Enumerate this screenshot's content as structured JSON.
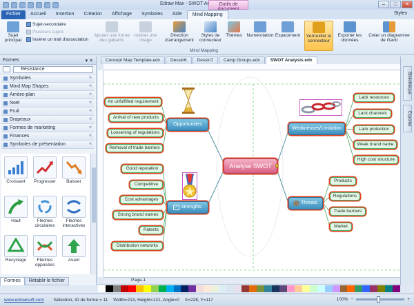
{
  "window": {
    "title": "Edraw Max - SWOT Analysis.edx",
    "contextual_tab": "Outils de document",
    "controls": [
      "–",
      "□",
      "✕"
    ]
  },
  "ribbon_tabs": [
    "Fichier",
    "Accueil",
    "Insertion",
    "Création",
    "Affichage",
    "Symboles",
    "Aide",
    "Mind Mapping"
  ],
  "active_tab": "Mind Mapping",
  "styles_label": "Styles",
  "ribbon": {
    "sujet_principal": "Sujet principal",
    "sujet_secondaire": "Sujet-secondaire",
    "plusieurs_sujets": "Plusieurs sujets",
    "inserer_trait": "Insérer un trait d'association",
    "ajouter_forme": "Ajouter une forme des gabarits",
    "inserer_image": "Insérer une image",
    "direction": "Direction d'arrangement",
    "styles_connecteur": "Styles de connecteur",
    "themes": "Thèmes",
    "numerotation": "Numérotation",
    "espacement": "Espacement",
    "verrouiller": "Verrouiller le connecteur",
    "exporter": "Exporter les données",
    "creer_gantt": "Créer un diagramme de Gantt",
    "group_name": "Mind Mapping"
  },
  "left_panel": {
    "title": "Formes",
    "search_value": "Résistance",
    "libraries": [
      "Symboles",
      "Mind Map Shapes",
      "Arrière-plan",
      "Noël",
      "Fruit",
      "Drapeaux",
      "Formes de marketing",
      "Finances",
      "Symboles de présentation"
    ],
    "shapes": [
      "Croissant",
      "Progresser",
      "Baisser",
      "Haut",
      "Flèches circulaires",
      "Flèches interactives",
      "Recyclage",
      "Flèches opposées",
      "Avant"
    ],
    "bottom_tabs": [
      "Formes",
      "Rétablir le fichier"
    ]
  },
  "doc_tabs": [
    "Concept Map Template.edx",
    "Dessin6",
    "Dessin7",
    "Camp Groups.edx",
    "SWOT Analysis.edx"
  ],
  "right_panel_tabs": [
    "Bibliothèque",
    "Exporter"
  ],
  "page_label": "Page-1",
  "mindmap": {
    "central": "Analyse SWOT",
    "topics": {
      "opportunities": "Opportunities",
      "weaknesses": "Weaknesses/Limitation",
      "strengths": "Strengths",
      "threats": "Threats"
    },
    "opportunities_items": [
      "An unfulfilled requirement",
      "Arrival of new products",
      "Loosening of regulations",
      "Removal of trade barriers"
    ],
    "weaknesses_items": [
      "Lack resources",
      "Lack channels",
      "Lack protection",
      "Weak brand name",
      "High cost structure"
    ],
    "strengths_items": [
      "Good reputation",
      "Competitive",
      "Cost advantages",
      "Strong brand names",
      "Patents",
      "Distribution networks"
    ],
    "threats_items": [
      "Products",
      "Regulations",
      "Trade barriers",
      "Market"
    ]
  },
  "palette_colors": [
    "#ffffff",
    "#000000",
    "#7f7f7f",
    "#c00000",
    "#ff0000",
    "#ffc000",
    "#ffff00",
    "#92d050",
    "#00b050",
    "#00b0f0",
    "#0070c0",
    "#002060",
    "#7030a0",
    "#f2dcdb",
    "#fde9d9",
    "#ebf1dd",
    "#dbeef3",
    "#dbe5f1",
    "#e5e0ec",
    "#953734",
    "#e36c09",
    "#76923c",
    "#31849b",
    "#17365d",
    "#5f497a",
    "#ff99cc",
    "#ffcc99",
    "#ffff99",
    "#ccffcc",
    "#ccffff",
    "#99ccff",
    "#cc99ff",
    "#996633",
    "#ff6600",
    "#339966",
    "#3366ff",
    "#993366",
    "#808000",
    "#008080",
    "#800080"
  ],
  "status": {
    "link": "www.edrawsoft.com",
    "info": "Sélection, ID de forme = 11",
    "dims": "Width=213, Height=121, Angle=0",
    "coords": "X=228, Y=117",
    "zoom": "100%"
  }
}
